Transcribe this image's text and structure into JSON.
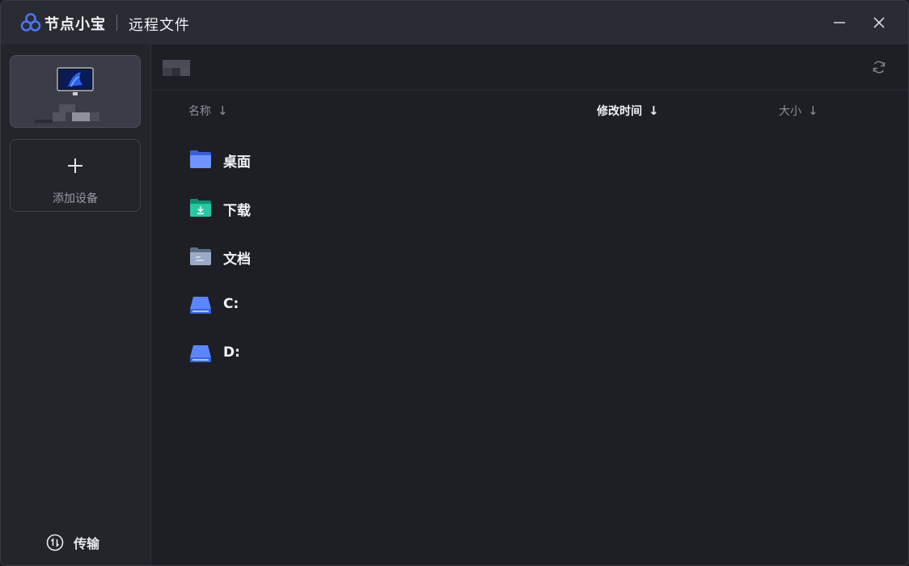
{
  "app": {
    "name": "节点小宝",
    "window_title": "远程文件"
  },
  "sidebar": {
    "add_device_label": "添加设备",
    "transfer_label": "传输"
  },
  "table": {
    "columns": [
      {
        "label": "名称",
        "sort_icon": "arrow-down"
      },
      {
        "label": "修改时间",
        "sort_icon": "arrow-down",
        "active": true
      },
      {
        "label": "大小",
        "sort_icon": "arrow-down"
      }
    ],
    "rows": [
      {
        "name": "桌面",
        "icon": "folder-desktop-icon"
      },
      {
        "name": "下载",
        "icon": "folder-download-icon"
      },
      {
        "name": "文档",
        "icon": "folder-documents-icon"
      },
      {
        "name": "C:",
        "icon": "drive-icon"
      },
      {
        "name": "D:",
        "icon": "drive-icon"
      }
    ]
  },
  "colors": {
    "accent": "#4a74f5",
    "download_folder": "#1fbf9a",
    "documents_folder": "#8a9ab6"
  }
}
